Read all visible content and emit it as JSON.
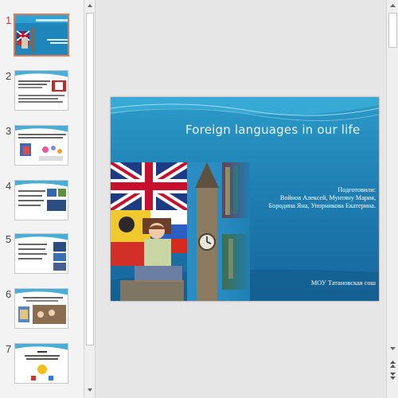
{
  "thumbnails": [
    {
      "number": "1",
      "active": true
    },
    {
      "number": "2",
      "active": false
    },
    {
      "number": "3",
      "active": false
    },
    {
      "number": "4",
      "active": false
    },
    {
      "number": "5",
      "active": false
    },
    {
      "number": "6",
      "active": false
    },
    {
      "number": "7",
      "active": false
    }
  ],
  "slide": {
    "title": "Foreign languages in our life",
    "prepared_lines": [
      "Подготовили:",
      "Войнов Алексей, Мунтяну Мария,",
      "Бородина Яна, Упорникова Екатерина."
    ],
    "school": "МОУ Татановская сош"
  },
  "colors": {
    "active_border": "#e07a54",
    "slide_blue": "#1f7fb3"
  },
  "icons": {
    "scroll_up": "triangle-up",
    "scroll_down": "triangle-down",
    "prev_slide": "double-triangle-up",
    "next_slide": "double-triangle-down"
  }
}
